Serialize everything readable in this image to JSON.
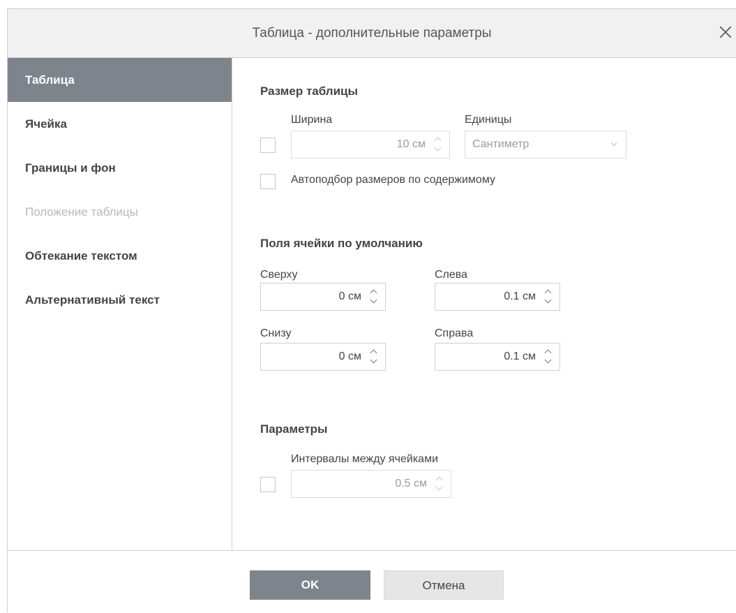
{
  "dialog": {
    "title": "Таблица - дополнительные параметры"
  },
  "sidebar": {
    "items": [
      {
        "label": "Таблица",
        "state": "active"
      },
      {
        "label": "Ячейка",
        "state": "normal"
      },
      {
        "label": "Границы и фон",
        "state": "normal"
      },
      {
        "label": "Положение таблицы",
        "state": "disabled"
      },
      {
        "label": "Обтекание текстом",
        "state": "normal"
      },
      {
        "label": "Альтернативный текст",
        "state": "normal"
      }
    ]
  },
  "table_size": {
    "section_title": "Размер таблицы",
    "width_label": "Ширина",
    "width_value": "10 см",
    "width_checked": false,
    "units_label": "Единицы",
    "units_value": "Сантиметр",
    "autofit_label": "Автоподбор размеров по содержимому",
    "autofit_checked": false
  },
  "cell_margins": {
    "section_title": "Поля ячейки по умолчанию",
    "top_label": "Сверху",
    "top_value": "0 см",
    "left_label": "Слева",
    "left_value": "0.1 см",
    "bottom_label": "Снизу",
    "bottom_value": "0 см",
    "right_label": "Справа",
    "right_value": "0.1 см"
  },
  "options": {
    "section_title": "Параметры",
    "spacing_label": "Интервалы между ячейками",
    "spacing_value": "0.5 см",
    "spacing_checked": false
  },
  "footer": {
    "ok_label": "OK",
    "cancel_label": "Отмена"
  },
  "colors": {
    "active_tab_bg": "#7e848b",
    "header_bg": "#f1f1f1",
    "border": "#cfcfcf"
  }
}
